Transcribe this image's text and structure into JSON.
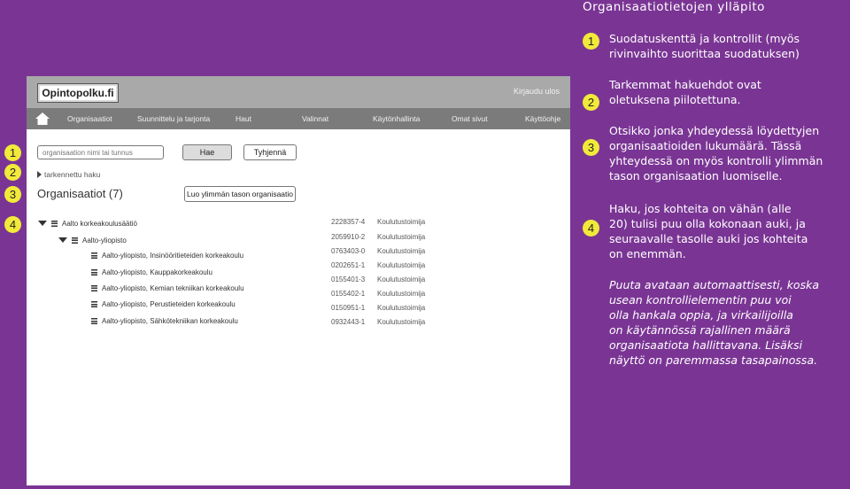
{
  "app": {
    "logo_text": "Opintopolku.fi",
    "logout_label": "Kirjaudu ulos"
  },
  "nav": {
    "items": [
      {
        "label": "Organisaatiot"
      },
      {
        "label": "Suunnittelu ja tarjonta"
      },
      {
        "label": "Haut"
      },
      {
        "label": "Valinnat"
      },
      {
        "label": "Käytönhallinta"
      },
      {
        "label": "Omat sivut"
      },
      {
        "label": "Käyttöohje"
      }
    ]
  },
  "search": {
    "placeholder": "organisaation nimi tai tunnus",
    "value": "",
    "search_button": "Hae",
    "clear_button": "Tyhjennä",
    "advanced_link": "tarkennettu haku"
  },
  "results": {
    "title": "Organisaatiot (7)",
    "create_button": "Luo ylimmän tason organisaatio",
    "tree": [
      {
        "label": "Aalto korkeakoulusäätiö"
      },
      {
        "label": "Aalto-yliopisto"
      },
      {
        "label": "Aalto-yliopisto, Insinööritieteiden korkeakoulu"
      },
      {
        "label": "Aalto-yliopisto, Kauppakorkeakoulu"
      },
      {
        "label": "Aalto-yliopisto, Kemian tekniikan korkeakoulu"
      },
      {
        "label": "Aalto-yliopisto, Perustieteiden korkeakoulu"
      },
      {
        "label": "Aalto-yliopisto, Sähkötekniikan korkeakoulu"
      }
    ],
    "codes": [
      {
        "code": "2228357-4",
        "type": "Koulutustoimija"
      },
      {
        "code": "2059910-2",
        "type": "Koulutustoimija"
      },
      {
        "code": "0763403-0",
        "type": "Koulutustoimija"
      },
      {
        "code": "0202651-1",
        "type": "Koulutustoimija"
      },
      {
        "code": "0155401-3",
        "type": "Koulutustoimija"
      },
      {
        "code": "0155402-1",
        "type": "Koulutustoimija"
      },
      {
        "code": "0150951-1",
        "type": "Koulutustoimija"
      },
      {
        "code": "0932443-1",
        "type": "Koulutustoimija"
      }
    ]
  },
  "badges": {
    "left": [
      "1",
      "2",
      "3",
      "4"
    ],
    "right": [
      "1",
      "2",
      "3",
      "4"
    ]
  },
  "annotations": {
    "title": "Organisaatiotietojen ylläpito",
    "a1": [
      "Suodatuskenttä ja kontrollit (myös",
      "rivinvaihto suorittaa suodatuksen)"
    ],
    "a2": [
      "Tarkemmat hakuehdot ovat",
      "oletuksena piilotettuna."
    ],
    "a3": [
      "Otsikko jonka yhdeydessä löydettyjen",
      "organisaatioiden lukumäärä. Tässä",
      "yhteydessä on myös kontrolli ylimmän",
      "tason organisaation luomiselle."
    ],
    "a4": [
      "Haku, jos kohteita on vähän (alle",
      "20) tulisi puu olla kokonaan auki, ja",
      "seuraavalle tasolle auki jos kohteita",
      "on enemmän."
    ],
    "note": [
      "Puuta avataan automaattisesti, koska",
      "usean kontrollielementin puu voi",
      "olla hankala oppia, ja virkailijoilla",
      "on käytännössä rajallinen määrä",
      "organisaatiota hallittavana. Lisäksi",
      "näyttö on paremmassa tasapainossa."
    ]
  },
  "colors": {
    "background": "#7a3594",
    "badge": "#f2ea3a",
    "topbar": "#a9a9a9",
    "navbar": "#7b7b7b"
  },
  "icons": {
    "home": "home-icon",
    "list_item": "list-icon",
    "expand": "caret-down-icon",
    "advanced": "triangle-right-icon"
  }
}
